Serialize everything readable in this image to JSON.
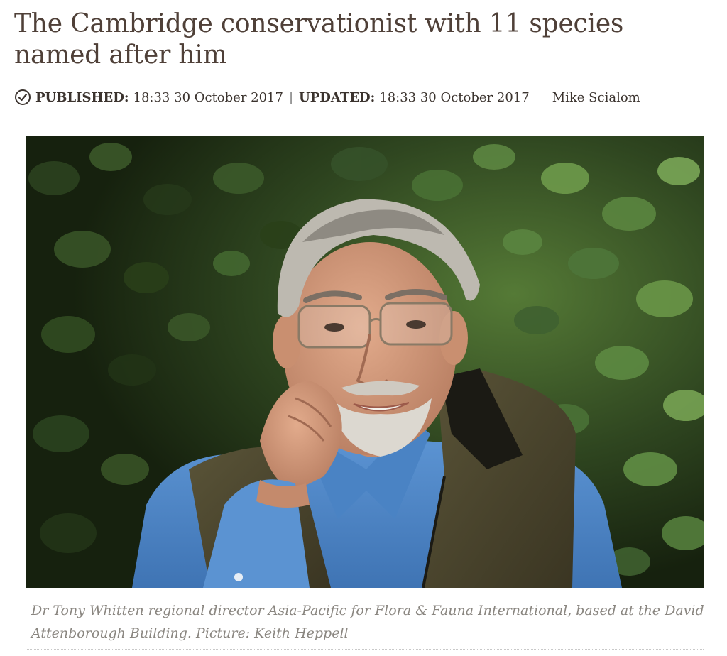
{
  "article": {
    "headline": "The Cambridge conservationist with 11 species named after him",
    "published_label": "PUBLISHED:",
    "published_time": "18:33 30 October 2017",
    "separator": "|",
    "updated_label": "UPDATED:",
    "updated_time": "18:33 30 October 2017",
    "author": "Mike Scialom",
    "icons": {
      "timestamp": "clock-icon"
    },
    "photo": {
      "subject": "Dr Tony Whitten"
    },
    "caption": "Dr Tony Whitten regional director Asia-Pacific for Flora & Fauna International, based at the David Attenborough Building. Picture: Keith Heppell"
  },
  "colors": {
    "headline": "#4f4038",
    "meta_text": "#3b332e",
    "caption": "#8a8680",
    "foliage_dark": "#1f2d14",
    "foliage_light": "#6f9a4a",
    "shirt_blue": "#4f86c6",
    "vest_olive": "#4b4630"
  }
}
